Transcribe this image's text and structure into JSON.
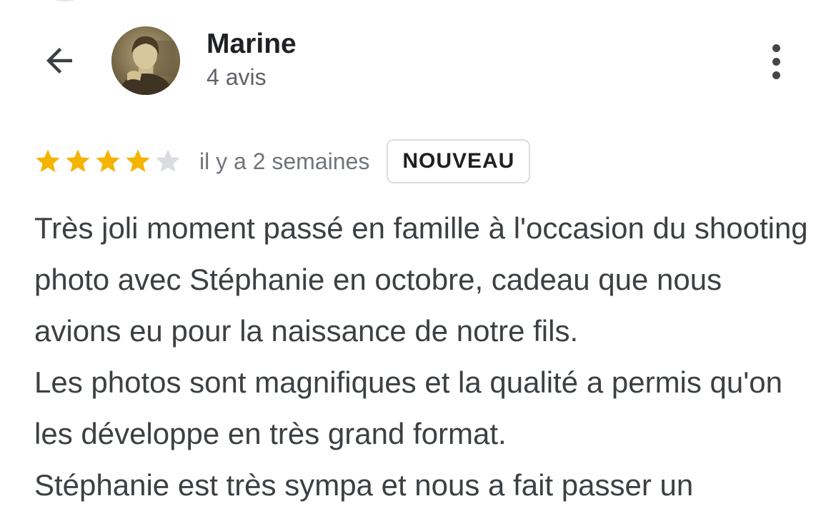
{
  "header": {
    "back_icon": "arrow-back-icon",
    "reviewer_name": "Marine",
    "review_count": "4 avis",
    "more_icon": "more-vertical-icon"
  },
  "review": {
    "rating": 4,
    "rating_max": 5,
    "star_color_filled": "#f4b400",
    "star_color_empty": "#dadce0",
    "date": "il y a 2 semaines",
    "badge": "NOUVEAU",
    "text": "Très joli moment passé en famille à l'occasion du shooting photo avec Stéphanie en octobre, cadeau que nous avions eu pour la naissance de notre fils.\nLes photos sont magnifiques et la qualité a permis qu'on les développe en très grand format.\nStéphanie est très sympa et nous a fait passer un"
  }
}
